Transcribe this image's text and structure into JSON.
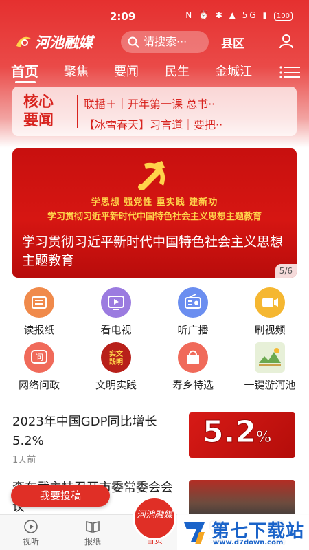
{
  "status": {
    "time": "2:09",
    "icons": "N ⏰ ✱ ▲ 5G ▮",
    "battery": "100"
  },
  "header": {
    "logo": "河池融媒",
    "search_placeholder": "请搜索···",
    "county": "县区"
  },
  "tabs": [
    {
      "label": "首页",
      "active": true
    },
    {
      "label": "聚焦"
    },
    {
      "label": "要闻"
    },
    {
      "label": "民生"
    },
    {
      "label": "金城江"
    }
  ],
  "core_news": {
    "label": "核心要闻",
    "line1": "联播＋｜开年第一课 总书··",
    "line2": "【冰雪春天】习言道｜要把··"
  },
  "banner": {
    "slogan": "学思想  强党性  重实践  建新功",
    "subtitle": "学习贯彻习近平新时代中国特色社会主义思想主题教育",
    "caption": "学习贯彻习近平新时代中国特色社会主义思想主题教育",
    "counter": "5/6"
  },
  "services": [
    {
      "label": "读报纸",
      "icon": "newspaper-icon",
      "color": "#f08a4b"
    },
    {
      "label": "看电视",
      "icon": "tv-icon",
      "color": "#9b7be0"
    },
    {
      "label": "听广播",
      "icon": "radio-icon",
      "color": "#6b8ef0"
    },
    {
      "label": "刷视频",
      "icon": "video-icon",
      "color": "#f5b731"
    },
    {
      "label": "网络问政",
      "icon": "inquiry-icon",
      "color": "#f06a5a"
    },
    {
      "label": "文明实践",
      "icon": "civilization-icon",
      "color": "#b8201a",
      "icon_text": "实文\n践明"
    },
    {
      "label": "寿乡特选",
      "icon": "shopping-bag-icon",
      "color": "#f06a5a"
    },
    {
      "label": "一键游河池",
      "icon": "tour-icon",
      "color": "#e7f0d8"
    }
  ],
  "news": [
    {
      "title": "2023年中国GDP同比增长5.2%",
      "time": "1天前",
      "thumb_text": "5.2",
      "thumb_unit": "%"
    },
    {
      "title": "李车武主持召开市委常委会会议"
    }
  ],
  "submit_button": "我要投稿",
  "bottom_nav": [
    {
      "label": "视听"
    },
    {
      "label": "报纸"
    },
    {
      "label": "首页",
      "active": true
    },
    {
      "label": "问政"
    },
    {
      "label": "服务"
    }
  ],
  "nav_center_logo": "河池融媒",
  "watermark": {
    "title": "第七下载站",
    "url": "www.d7down.com"
  }
}
